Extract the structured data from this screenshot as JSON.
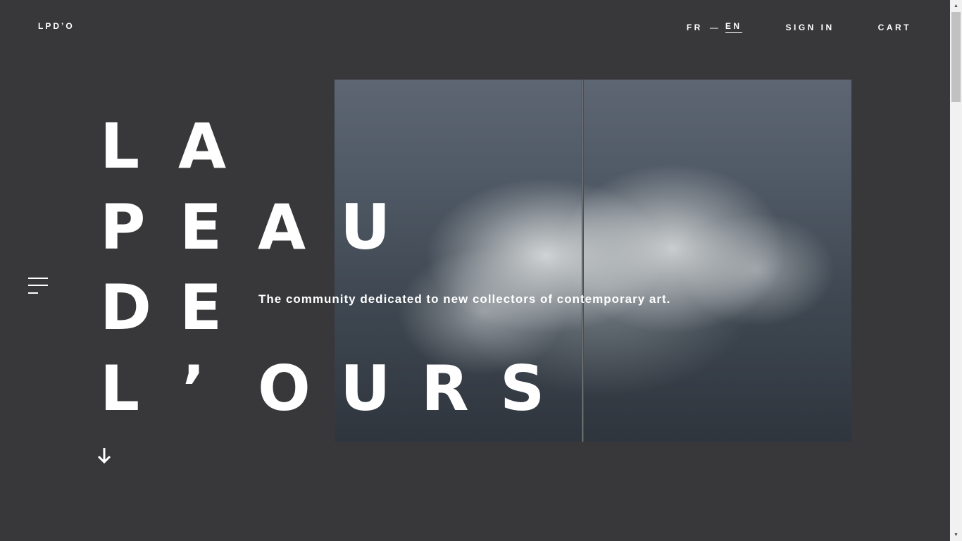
{
  "header": {
    "logo": "LPD’O",
    "lang": {
      "fr": "FR",
      "separator": "—",
      "en": "EN",
      "active": "EN"
    },
    "sign_in": "SIGN IN",
    "cart": "CART"
  },
  "hero": {
    "title_lines": [
      [
        "L",
        "A"
      ],
      [
        "P",
        "E",
        "A",
        "U"
      ],
      [
        "D",
        "E"
      ],
      [
        "L",
        "’",
        "O",
        "U",
        "R",
        "S"
      ]
    ],
    "tagline": "The community dedicated to new collectors of contemporary art."
  },
  "icons": {
    "menu": "hamburger-menu-icon",
    "scroll_down": "arrow-down-icon"
  },
  "colors": {
    "background": "#38383a",
    "text": "#ffffff"
  }
}
